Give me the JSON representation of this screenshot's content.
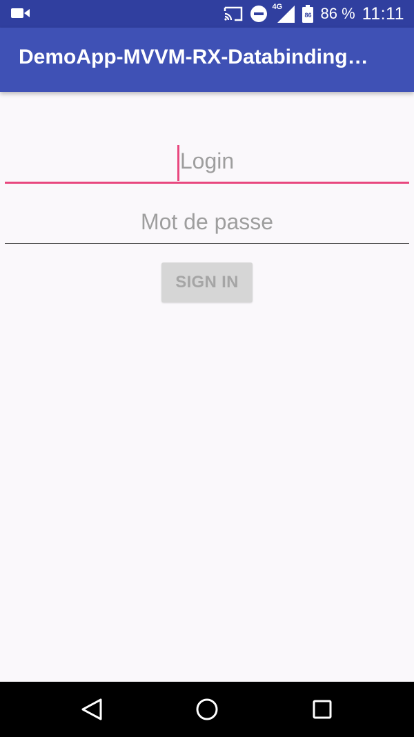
{
  "status_bar": {
    "network": "4G",
    "battery_badge": "86",
    "battery_percent": "86 %",
    "time": "11:11",
    "icons": [
      "video-camera-icon",
      "cast-icon",
      "do-not-disturb-icon",
      "signal-icon",
      "battery-icon"
    ]
  },
  "app_bar": {
    "title": "DemoApp-MVVM-RX-Databinding…"
  },
  "form": {
    "login_placeholder": "Login",
    "password_placeholder": "Mot de passe",
    "sign_in_label": "SIGN IN"
  },
  "nav_bar": {
    "icons": [
      "back-icon",
      "home-icon",
      "recents-icon"
    ]
  },
  "colors": {
    "status_bar": "#303F9F",
    "app_bar": "#3F51B5",
    "accent": "#E8477E",
    "background": "#FAF8FB",
    "disabled_button": "#D6D6D6"
  }
}
